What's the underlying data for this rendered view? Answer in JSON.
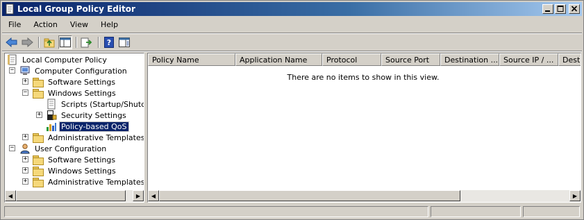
{
  "window": {
    "title": "Local Group Policy Editor"
  },
  "menu": [
    "File",
    "Action",
    "View",
    "Help"
  ],
  "toolbar": {
    "icons": [
      "back-icon",
      "forward-icon",
      "up-folder-icon",
      "show-hide-tree-icon",
      "export-list-icon",
      "help-icon",
      "properties-icon"
    ]
  },
  "tree": {
    "root": "Local Computer Policy",
    "computer_config": "Computer Configuration",
    "software_settings": "Software Settings",
    "windows_settings": "Windows Settings",
    "scripts": "Scripts (Startup/Shutdow",
    "security_settings": "Security Settings",
    "policy_qos": "Policy-based QoS",
    "admin_templates": "Administrative Templates",
    "user_config": "User Configuration",
    "user_software_settings": "Software Settings",
    "user_windows_settings": "Windows Settings",
    "user_admin_templates": "Administrative Templates"
  },
  "list": {
    "columns": [
      "Policy Name",
      "Application Name",
      "Protocol",
      "Source Port",
      "Destination ...",
      "Source IP / ...",
      "Destin"
    ],
    "empty_message": "There are no items to show in this view."
  },
  "colors": {
    "selection": "#0a246a",
    "title_start": "#0a246a",
    "title_end": "#a6caf0"
  }
}
